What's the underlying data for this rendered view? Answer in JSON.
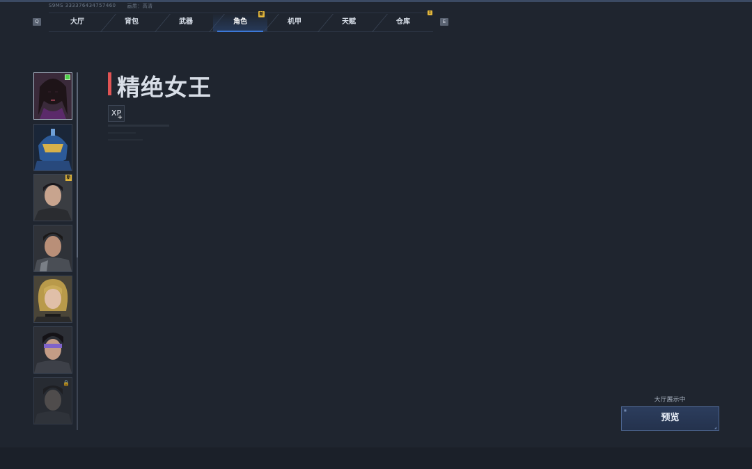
{
  "status": {
    "left_text": "S9MS  333376434757460",
    "quality_label": "画质：高清"
  },
  "keys": {
    "left": "Q",
    "right": "E"
  },
  "tabs": [
    {
      "label": "大厅",
      "active": false,
      "badge": ""
    },
    {
      "label": "背包",
      "active": false,
      "badge": ""
    },
    {
      "label": "武器",
      "active": false,
      "badge": ""
    },
    {
      "label": "角色",
      "active": true,
      "badge": "新"
    },
    {
      "label": "机甲",
      "active": false,
      "badge": ""
    },
    {
      "label": "天赋",
      "active": false,
      "badge": ""
    },
    {
      "label": "仓库",
      "active": false,
      "badge": "!"
    }
  ],
  "characters": [
    {
      "id": "c1",
      "selected": true,
      "status": "equipped"
    },
    {
      "id": "c2",
      "selected": false,
      "status": ""
    },
    {
      "id": "c3",
      "selected": false,
      "status": "new",
      "tag": "新"
    },
    {
      "id": "c4",
      "selected": false,
      "status": ""
    },
    {
      "id": "c5",
      "selected": false,
      "status": ""
    },
    {
      "id": "c6",
      "selected": false,
      "status": ""
    },
    {
      "id": "c7",
      "selected": false,
      "status": "locked"
    }
  ],
  "detail": {
    "name": "精绝女王",
    "xp_label": "XP",
    "xp_plus": "+"
  },
  "lobby_status": "大厅展示中",
  "preview_button": "预览",
  "icons": [
    "xp-plus-icon",
    "lock-icon",
    "new-badge-icon"
  ],
  "colors": {
    "accent_red": "#e05454",
    "active_tab": "#3c78d8",
    "badge_yellow": "#e2b63b",
    "equipped_green": "#4fd04a"
  }
}
